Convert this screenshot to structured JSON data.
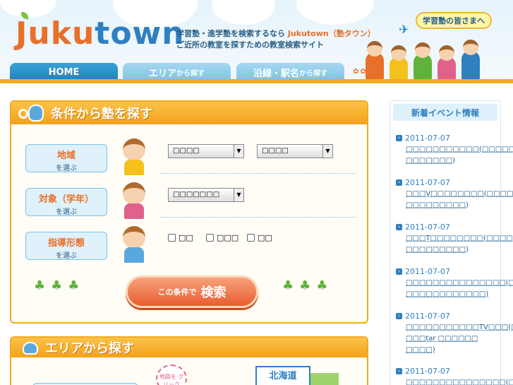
{
  "header": {
    "logo_main": "Juku",
    "logo_accent": "town",
    "tagline_line1_a": "学習塾・進学塾を検索するなら ",
    "tagline_brand": "Jukutown（塾タウン）",
    "tagline_line2": "ご近所の教室を探すための教室検索サイト",
    "juku_button": "学習塾の皆さまへ"
  },
  "nav": {
    "home": "HOME",
    "area_main": "エリア",
    "area_small": "から探す",
    "line_main": "沿線・駅名",
    "line_small": "から探す"
  },
  "search": {
    "title": "条件から塾を探す",
    "rows": [
      {
        "main": "地域",
        "sub": "を選ぶ"
      },
      {
        "main": "対象（学年）",
        "sub": "を選ぶ"
      },
      {
        "main": "指導形態",
        "sub": "を選ぶ"
      }
    ],
    "region_select_1": "□□□□",
    "region_select_2": "□□□□",
    "grade_select": "□□□□□□□",
    "checkboxes": [
      "□□",
      "□□□",
      "□□"
    ],
    "button_small": "この条件で",
    "button_big": "検索"
  },
  "area": {
    "title": "エリアから探す",
    "stamp": "地図を クリック",
    "region": "北海道"
  },
  "sidebar": {
    "title": "新着イベント情報",
    "events": [
      {
        "date": "2011-07-07",
        "text": "□□□□□□□□□□□(□□□□□□ □□□□□□□)"
      },
      {
        "date": "2011-07-07",
        "text": "□□□V□□□□□□□□(□□□□ □□□□□□□□□)"
      },
      {
        "date": "2011-07-07",
        "text": "□□□T□□□□□□□□(□□□□ □□□□□□□□□)"
      },
      {
        "date": "2011-07-07",
        "text": "□□□□□□□□□□□□□□□(□□ □□□□□□□□□□□□)"
      },
      {
        "date": "2011-07-07",
        "text": "□□□□□□□□□□□TV□□□(□ □□□tar □□□□□□ □□□□)"
      },
      {
        "date": "2011-07-07",
        "text": "□□□□□□□□□□□□□□□(□"
      }
    ]
  },
  "colors": {
    "orange": "#f4a91d",
    "blue": "#2f7fc1",
    "accent": "#e8702a"
  }
}
